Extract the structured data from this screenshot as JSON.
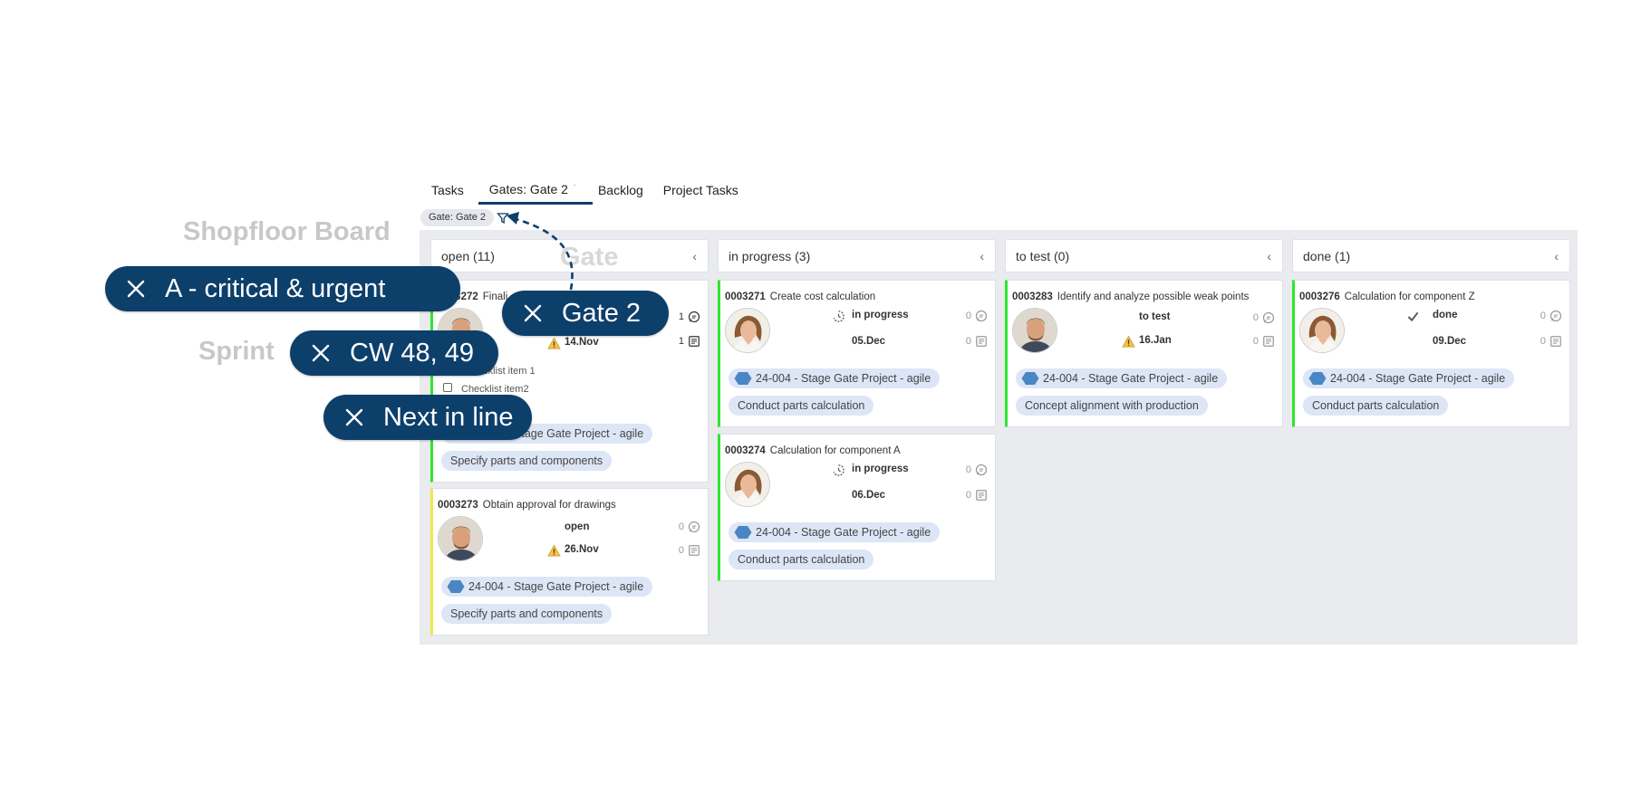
{
  "tabs": [
    {
      "label": "Tasks"
    },
    {
      "label": "Gates: Gate 2",
      "caret": "˙"
    },
    {
      "label": "Backlog"
    },
    {
      "label": "Project Tasks"
    }
  ],
  "active_filter_chip": "Gate: Gate 2",
  "ghost_labels": {
    "board": "Shopfloor Board",
    "gate": "Gate",
    "sprint": "Sprint"
  },
  "overlay_pills": [
    {
      "label": "A - critical & urgent"
    },
    {
      "label": "Gate 2"
    },
    {
      "label": "CW 48, 49"
    },
    {
      "label": "Next in line"
    }
  ],
  "columns": [
    {
      "title": "open (11)"
    },
    {
      "title": "in progress (3)"
    },
    {
      "title": "to test (0)"
    },
    {
      "title": "done (1)"
    }
  ],
  "cards": {
    "c3272": {
      "id": "0003272",
      "title": "Finali",
      "date": "14.Nov",
      "comments": "1",
      "notes": "1",
      "checklist": [
        "Checklist item 1",
        "Checklist item2"
      ],
      "project": "24-004 - Stage Gate Project - agile",
      "tag": "Specify parts and components"
    },
    "c3273": {
      "id": "0003273",
      "title": "Obtain approval for drawings",
      "status": "open",
      "date": "26.Nov",
      "comments": "0",
      "notes": "0",
      "project": "24-004 - Stage Gate Project - agile",
      "tag": "Specify parts and components"
    },
    "c3271": {
      "id": "0003271",
      "title": "Create cost calculation",
      "status": "in progress",
      "date": "05.Dec",
      "comments": "0",
      "notes": "0",
      "project": "24-004 - Stage Gate Project - agile",
      "tag": "Conduct parts calculation"
    },
    "c3274": {
      "id": "0003274",
      "title": "Calculation for component A",
      "status": "in progress",
      "date": "06.Dec",
      "comments": "0",
      "notes": "0",
      "project": "24-004 - Stage Gate Project - agile",
      "tag": "Conduct parts calculation"
    },
    "c3283": {
      "id": "0003283",
      "title": "Identify and analyze possible weak points",
      "status": "to test",
      "date": "16.Jan",
      "comments": "0",
      "notes": "0",
      "project": "24-004 - Stage Gate Project - agile",
      "tag": "Concept alignment with production"
    },
    "c3276": {
      "id": "0003276",
      "title": "Calculation for component Z",
      "status": "done",
      "date": "09.Dec",
      "comments": "0",
      "notes": "0",
      "project": "24-004 - Stage Gate Project - agile",
      "tag": "Conduct parts calculation"
    }
  },
  "colors": {
    "accent": "#0d3f6b",
    "board_bg": "#e9ebef",
    "card_border_green": "#2ee62e",
    "card_border_yellow": "#f0e84a",
    "chip_bg": "#dde6f6"
  }
}
